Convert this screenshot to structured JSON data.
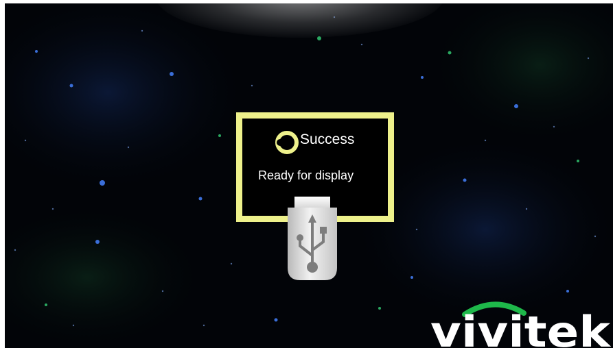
{
  "colors": {
    "accent": "#eef18b",
    "background": "#020408",
    "text": "#ffffff",
    "brand_green": "#1eb84a"
  },
  "status": {
    "icon": "circle-ring-icon",
    "title": "Success",
    "message": "Ready for display"
  },
  "device": {
    "icon": "usb-drive-icon"
  },
  "brand": {
    "logo": "vivitek",
    "icon": "vivitek-logo"
  }
}
